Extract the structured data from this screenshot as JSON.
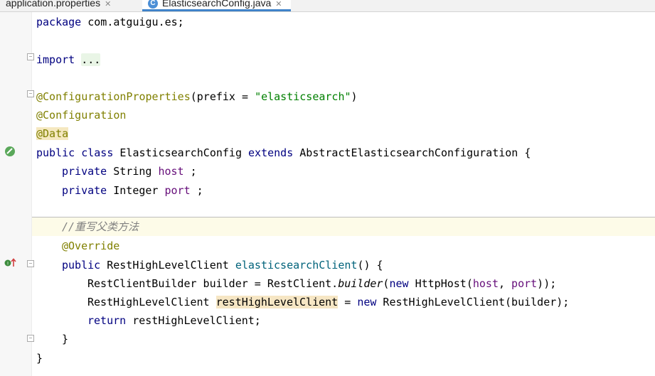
{
  "tabs": [
    {
      "label": "application.properties",
      "active": false
    },
    {
      "label": "ElasticsearchConfig.java",
      "active": true,
      "icon": "C"
    }
  ],
  "code": {
    "l1_package": "package",
    "l1_name": " com.atguigu.es;",
    "l2_import": "import",
    "l2_fold": "...",
    "l3_ann": "@ConfigurationProperties",
    "l3_open": "(prefix = ",
    "l3_str": "\"elasticsearch\"",
    "l3_close": ")",
    "l4_ann": "@Configuration",
    "l5_ann": "@Data",
    "l6_public": "public",
    "l6_class": " class",
    "l6_name": " ElasticsearchConfig ",
    "l6_extends": "extends",
    "l6_rest": " AbstractElasticsearchConfiguration {",
    "l7_private": "private",
    "l7_type": " String ",
    "l7_field": "host",
    "l7_end": " ;",
    "l8_private": "private",
    "l8_type": " Integer ",
    "l8_field": "port",
    "l8_end": " ;",
    "l9_comment": "//重写父类方法",
    "l10_ann": "@Override",
    "l11_public": "public",
    "l11_type": " RestHighLevelClient ",
    "l11_method": "elasticsearchClient",
    "l11_end": "() {",
    "l12_a": "RestClientBuilder builder = RestClient.",
    "l12_builder": "builder",
    "l12_b": "(",
    "l12_new": "new",
    "l12_c": " HttpHost(",
    "l12_host": "host",
    "l12_d": ", ",
    "l12_port": "port",
    "l12_e": "));",
    "l13_a": "RestHighLevelClient ",
    "l13_var": "restHighLevelClient",
    "l13_b": " = ",
    "l13_new": "new",
    "l13_c": " RestHighLevelClient(builder);",
    "l14_return": "return",
    "l14_rest": " restHighLevelClient;",
    "l15_close": "}",
    "l16_close": "}"
  },
  "colors": {
    "keyword": "#000080",
    "annotation": "#808000",
    "field": "#660e7a",
    "string": "#008000",
    "comment": "#808080"
  },
  "gutter_icons": [
    "bean-icon",
    "implements-override-icon"
  ]
}
